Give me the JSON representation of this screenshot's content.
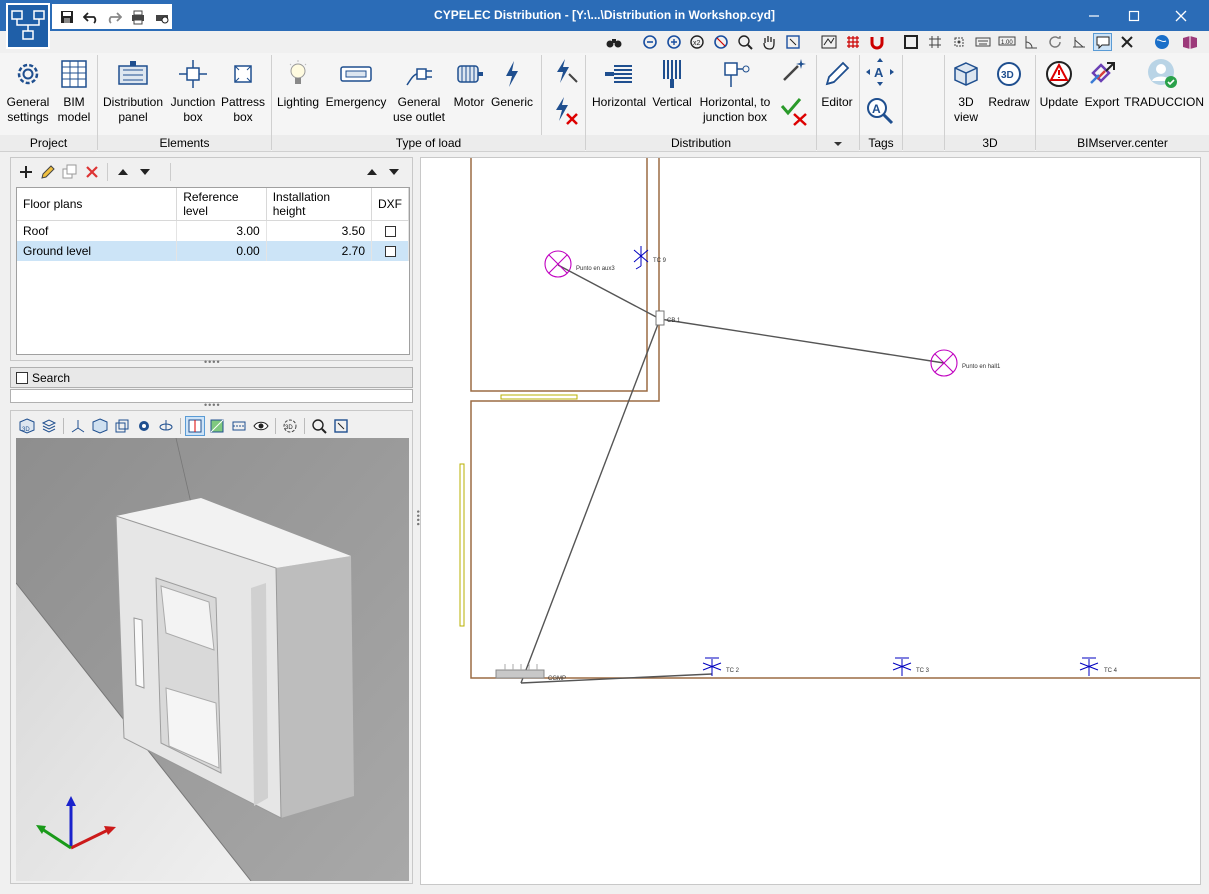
{
  "window": {
    "title": "CYPELEC Distribution - [Y:\\...\\Distribution in Workshop.cyd]",
    "controls": [
      "minimize",
      "maximize",
      "close"
    ]
  },
  "ribbon": {
    "groups": [
      {
        "label": "Project",
        "buttons": [
          {
            "label": "General settings",
            "icon": "gear-icon"
          },
          {
            "label": "BIM model",
            "icon": "bim-model-icon"
          }
        ]
      },
      {
        "label": "Elements",
        "buttons": [
          {
            "label": "Distribution panel",
            "icon": "distribution-panel-icon"
          },
          {
            "label": "Junction box",
            "icon": "junction-box-icon"
          },
          {
            "label": "Pattress box",
            "icon": "pattress-box-icon"
          }
        ]
      },
      {
        "label": "Type of load",
        "buttons": [
          {
            "label": "Lighting",
            "icon": "lighting-icon"
          },
          {
            "label": "Emergency",
            "icon": "emergency-icon"
          },
          {
            "label": "General use outlet",
            "icon": "outlet-icon"
          },
          {
            "label": "Motor",
            "icon": "motor-icon"
          },
          {
            "label": "Generic",
            "icon": "generic-load-icon"
          }
        ]
      },
      {
        "label": "Distribution",
        "buttons": [
          {
            "label": "Horizontal",
            "icon": "horizontal-distribution-icon"
          },
          {
            "label": "Vertical",
            "icon": "vertical-distribution-icon"
          },
          {
            "label": "Horizontal, to junction box",
            "icon": "horizontal-junction-icon"
          }
        ]
      },
      {
        "label": "",
        "buttons": [
          {
            "label": "Editor",
            "icon": "editor-icon"
          }
        ]
      },
      {
        "label": "Tags",
        "buttons": []
      },
      {
        "label": "3D",
        "buttons": [
          {
            "label": "3D view",
            "icon": "cube-3d-icon"
          },
          {
            "label": "Redraw",
            "icon": "redraw-icon"
          }
        ]
      },
      {
        "label": "BIMserver.center",
        "buttons": [
          {
            "label": "Update",
            "icon": "update-icon"
          },
          {
            "label": "Export",
            "icon": "export-icon"
          },
          {
            "label": "TRADUCCION",
            "icon": "user-icon"
          }
        ]
      }
    ]
  },
  "floor_plans": {
    "columns": [
      "Floor plans",
      "Reference level",
      "Installation height",
      "DXF"
    ],
    "rows": [
      {
        "name": "Roof",
        "reference_level": "3.00",
        "installation_height": "3.50",
        "dxf": false,
        "selected": false
      },
      {
        "name": "Ground level",
        "reference_level": "0.00",
        "installation_height": "2.70",
        "dxf": false,
        "selected": true
      }
    ]
  },
  "search": {
    "label": "Search",
    "checked": false
  },
  "drawing": {
    "labels": {
      "light1": "Punto en aux3",
      "light2": "Punto en hall1",
      "tc9": "TC 9",
      "cb1": "CB 1",
      "tc2": "TC 2",
      "tc3": "TC 3",
      "tc4": "TC 4",
      "panel": "CGMP"
    }
  },
  "colors": {
    "titlebar": "#2b6cb7",
    "wall": "#9b6b43",
    "light_symbol": "#c000c0",
    "outlet_symbol": "#0000c0",
    "wire": "#555555",
    "door": "#b8b000"
  }
}
